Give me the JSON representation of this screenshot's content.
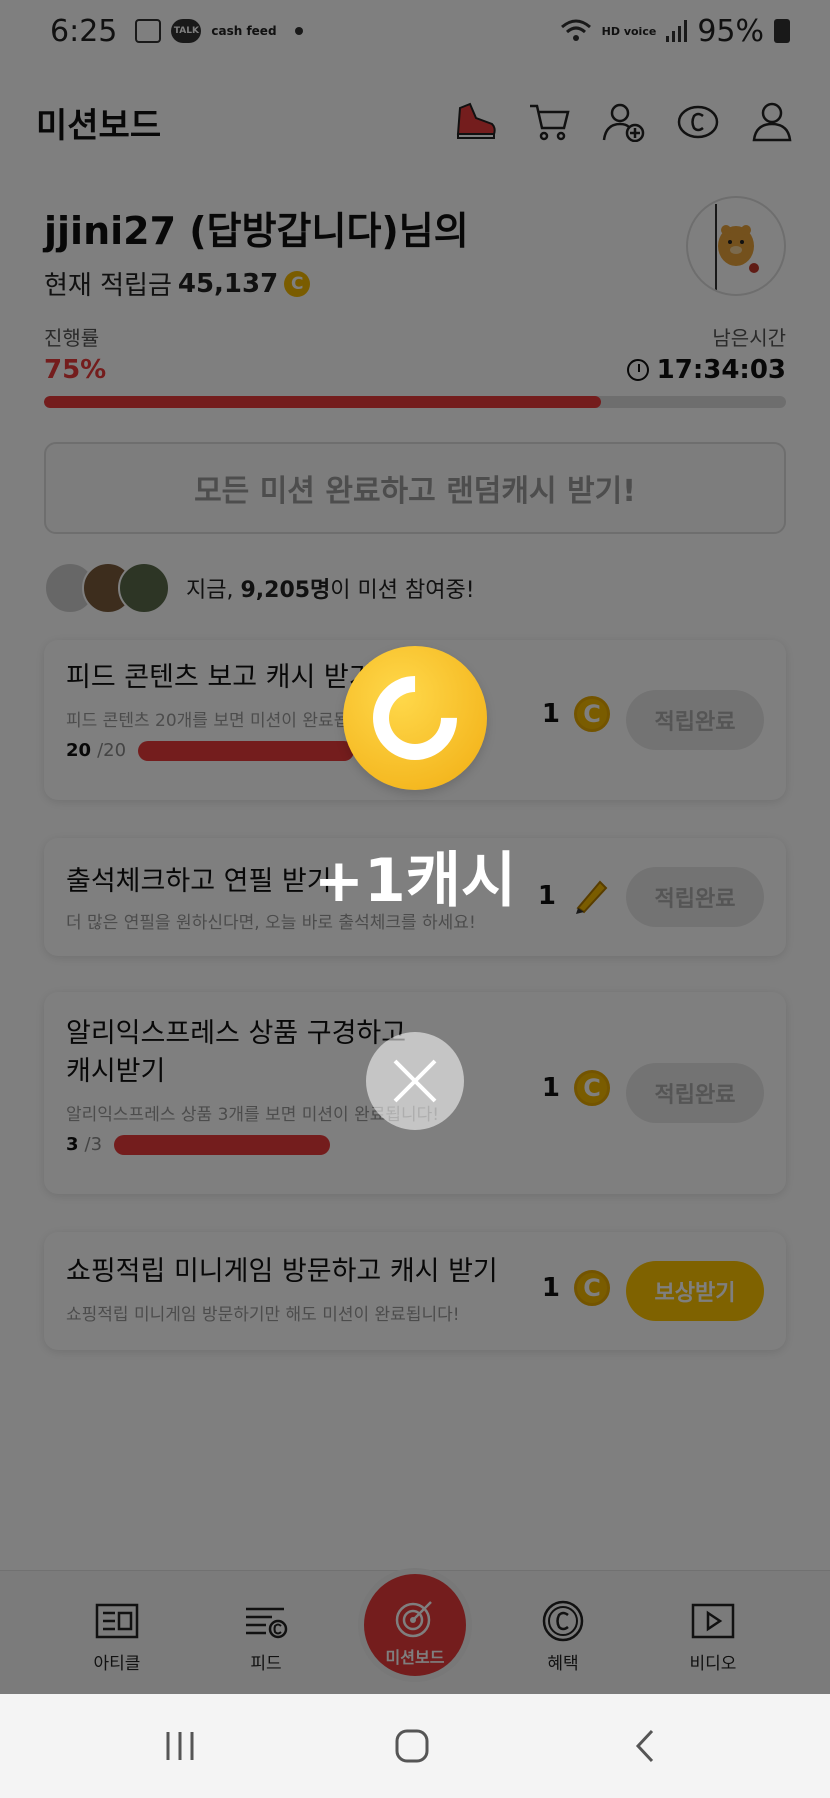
{
  "status_bar": {
    "time": "6:25",
    "app_icons": [
      "image-icon",
      "talk-icon",
      "cashfeed-icon"
    ],
    "talk_label": "TALK",
    "cashfeed_label": "cash feed",
    "hd_label": "HD voice",
    "battery": "95%"
  },
  "header": {
    "title": "미션보드",
    "icons": [
      "sneaker-icon",
      "cart-icon",
      "add-friend-icon",
      "cash-coin-icon",
      "profile-icon"
    ]
  },
  "profile": {
    "name": "jjini27 (답방갑니다)님의",
    "balance_label": "현재 적립금",
    "balance_value": "45,137",
    "coin_symbol": "C"
  },
  "progress": {
    "label": "진행률",
    "percent_text": "75%",
    "fraction": 0.75,
    "remaining_label": "남은시간",
    "remaining_time": "17:34:03"
  },
  "cta": {
    "label": "모든 미션 완료하고 랜덤캐시 받기!"
  },
  "participants": {
    "prefix": "지금, ",
    "count": "9,205명",
    "suffix": "이 미션 참여중!"
  },
  "missions": [
    {
      "title": "피드 콘텐츠 보고 캐시 받기",
      "desc": "피드 콘텐츠 20개를 보면 미션이 완료됩니다!",
      "done": "20",
      "total": "/20",
      "fraction": 1.0,
      "reward": "1",
      "reward_icon": "coin-icon",
      "button": "적립완료"
    },
    {
      "title": "출석체크하고 연필 받기",
      "desc": "더 많은 연필을 원하신다면, 오늘 바로 출석체크를 하세요!",
      "reward": "1",
      "reward_icon": "pencil-icon",
      "button": "적립완료"
    },
    {
      "title_line1": "알리익스프레스 상품 구경하고",
      "title_line2": "캐시받기",
      "desc": "알리익스프레스 상품 3개를 보면 미션이 완료됩니다!",
      "done": "3",
      "total": "/3",
      "fraction": 1.0,
      "reward": "1",
      "reward_icon": "coin-icon",
      "button": "적립완료"
    },
    {
      "title": "쇼핑적립 미니게임 방문하고 캐시 받기",
      "desc": "쇼핑적립 미니게임 방문하기만 해도 미션이 완료됩니다!",
      "reward": "1",
      "reward_icon": "coin-icon",
      "button": "보상받기"
    }
  ],
  "bottom_nav": {
    "items": [
      "아티클",
      "피드",
      "미션보드",
      "혜택",
      "비디오"
    ]
  },
  "popup": {
    "reward_text": "+1캐시",
    "coin_icon": "cash-coin-icon",
    "close_icon": "close-icon"
  },
  "colors": {
    "accent_red": "#e83a3a",
    "coin_yellow": "#f5b800",
    "active_button": "#ffc400"
  }
}
